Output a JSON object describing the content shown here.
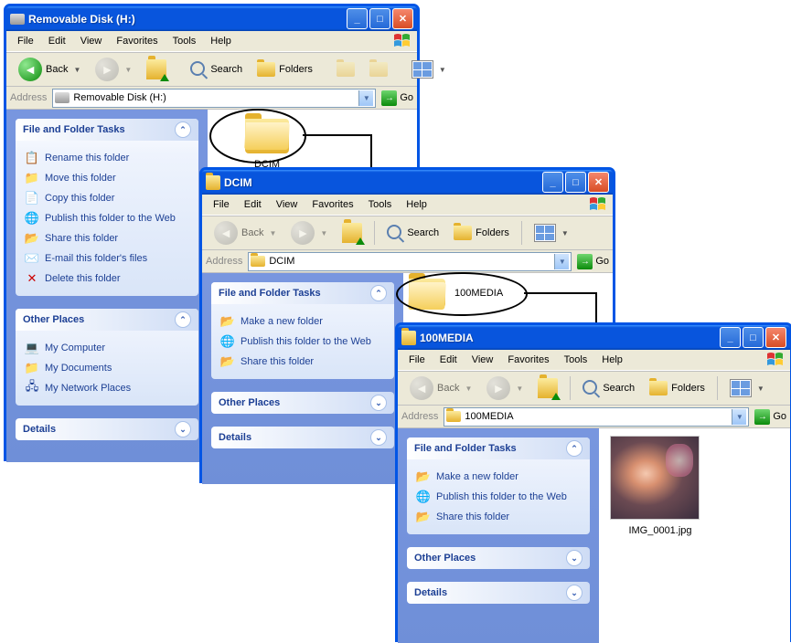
{
  "windows": {
    "w1": {
      "title": "Removable Disk (H:)",
      "address": "Removable Disk (H:)",
      "content_folder": "DCIM",
      "tasks_title": "File and Folder Tasks",
      "tasks": {
        "rename": "Rename this folder",
        "move": "Move this folder",
        "copy": "Copy this folder",
        "publish": "Publish this folder to the Web",
        "share": "Share this folder",
        "email": "E-mail this folder's files",
        "delete": "Delete this folder"
      },
      "other_title": "Other Places",
      "other": {
        "computer": "My Computer",
        "documents": "My Documents",
        "network": "My Network Places"
      },
      "details_title": "Details"
    },
    "w2": {
      "title": "DCIM",
      "address": "DCIM",
      "content_folder": "100MEDIA",
      "tasks_title": "File and Folder Tasks",
      "tasks": {
        "new": "Make a new folder",
        "publish": "Publish this folder to the Web",
        "share": "Share this folder"
      },
      "other_title": "Other Places",
      "details_title": "Details"
    },
    "w3": {
      "title": "100MEDIA",
      "address": "100MEDIA",
      "content_file": "IMG_0001.jpg",
      "tasks_title": "File and Folder Tasks",
      "tasks": {
        "new": "Make a new folder",
        "publish": "Publish this folder to the Web",
        "share": "Share this folder"
      },
      "other_title": "Other Places",
      "details_title": "Details"
    }
  },
  "menu": {
    "file": "File",
    "edit": "Edit",
    "view": "View",
    "favorites": "Favorites",
    "tools": "Tools",
    "help": "Help"
  },
  "toolbar": {
    "back": "Back",
    "search": "Search",
    "folders": "Folders",
    "go": "Go"
  },
  "address_label": "Address"
}
